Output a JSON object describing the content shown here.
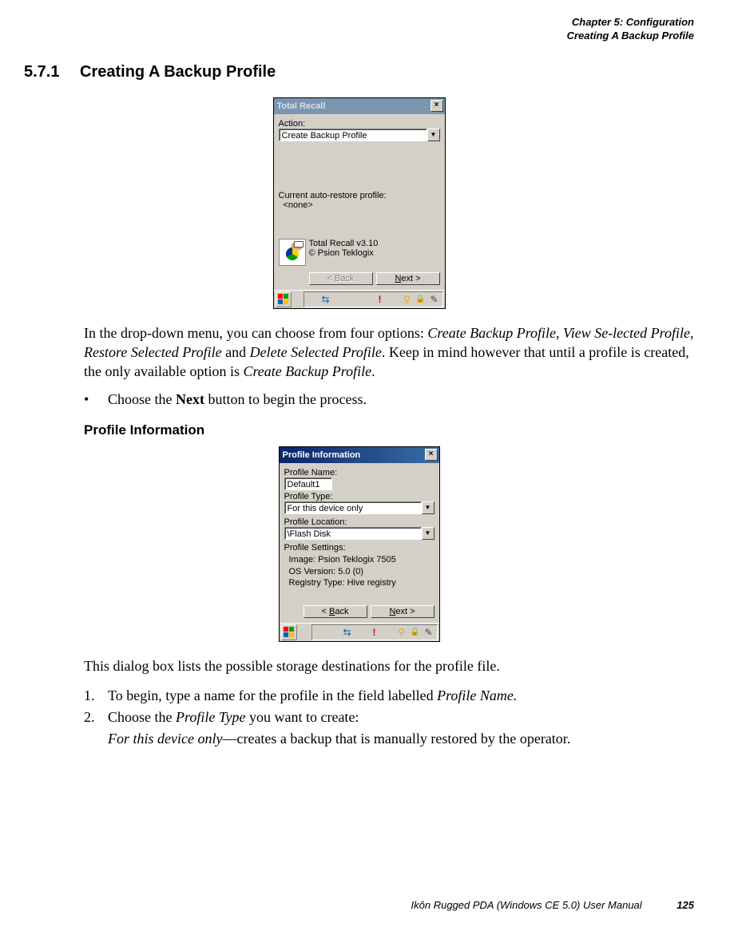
{
  "header": {
    "l1": "Chapter 5:  Configuration",
    "l2": "Creating A Backup Profile"
  },
  "section": {
    "num": "5.7.1",
    "title": "Creating A Backup Profile"
  },
  "fig1": {
    "title": "Total Recall",
    "action_label": "Action:",
    "action_value": "Create Backup Profile",
    "current_label": "Current auto-restore profile:",
    "current_value": "<none>",
    "about_l1": "Total Recall v3.10",
    "about_l2": "© Psion Teklogix",
    "back": "< Back",
    "next": "Next >"
  },
  "p1": {
    "t1": "In the drop-down menu, you can choose from four options: ",
    "o1": "Create Backup Profile",
    "c1": ", ",
    "o2": "View Se-lected Profile",
    "c2": ", ",
    "o3": "Restore Selected Profile",
    "c3": " and ",
    "o4": "Delete Selected Profile",
    "t2": ". Keep in mind however that until a profile is created, the only available option is ",
    "o5": "Create Backup Profile",
    "t3": "."
  },
  "bullet": {
    "t1": "Choose the ",
    "b1": "Next",
    "t2": " button to begin the process."
  },
  "subhead": "Profile Information",
  "fig2": {
    "title": "Profile Information",
    "name_label": "Profile Name:",
    "name_value": "Default1",
    "type_label": "Profile Type:",
    "type_value": "For this device only",
    "loc_label": "Profile Location:",
    "loc_value": "\\Flash Disk",
    "settings_label": "Profile Settings:",
    "s1": "Image: Psion Teklogix 7505",
    "s2": "OS Version: 5.0 (0)",
    "s3": "Registry Type: Hive registry",
    "back": "< Back",
    "next": "Next >"
  },
  "p2": "This dialog box lists the possible storage destinations for the profile file.",
  "ol": {
    "n1": "1.",
    "t1a": "To begin, type a name for the profile in the field labelled ",
    "t1b": "Profile Name.",
    "n2": "2.",
    "t2a": "Choose the ",
    "t2b": "Profile Type",
    "t2c": " you want to create:",
    "t3a": "For this device only",
    "t3b": "—creates a backup that is manually restored by the operator."
  },
  "footer": {
    "book": "Ikôn Rugged PDA (Windows CE 5.0) User Manual",
    "page": "125"
  }
}
